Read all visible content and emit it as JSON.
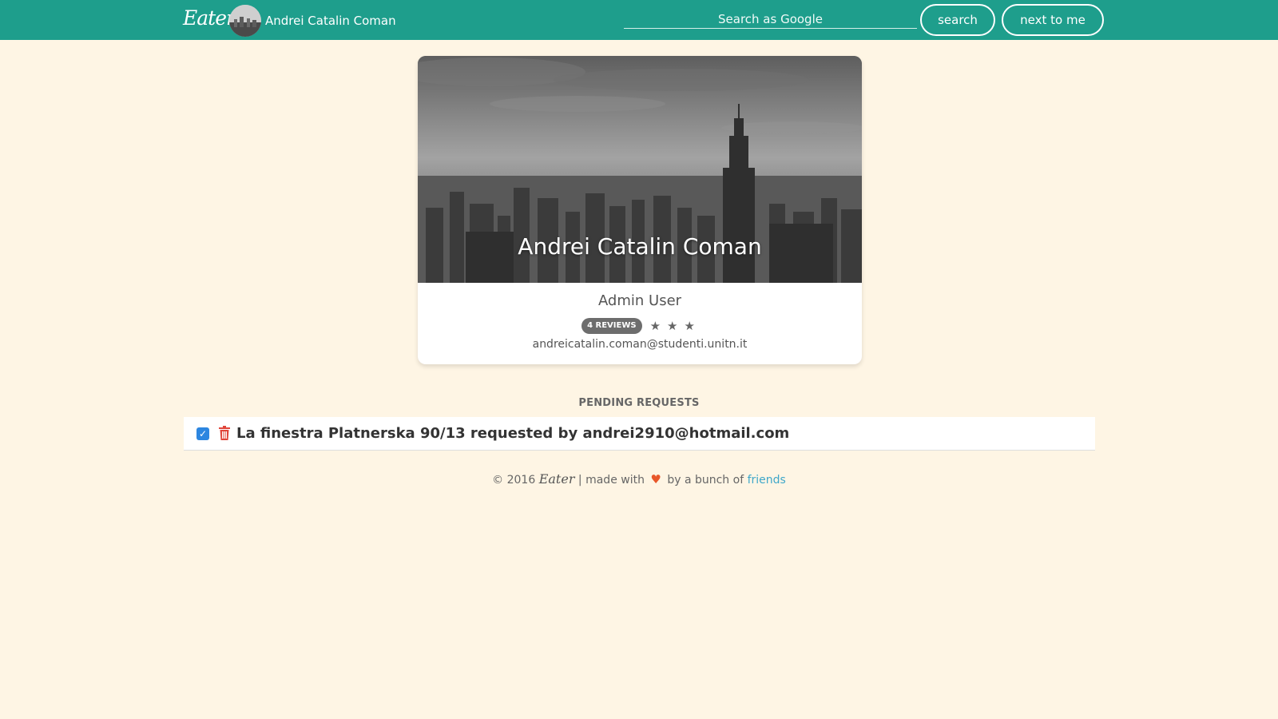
{
  "navbar": {
    "brand": "Eater",
    "username": "Andrei Catalin Coman",
    "search_placeholder": "Search as Google",
    "search_button": "search",
    "next_button": "next to me"
  },
  "profile": {
    "name": "Andrei Catalin Coman",
    "role": "Admin User",
    "reviews_badge": "4 REVIEWS",
    "stars": 3,
    "email": "andreicatalin.coman@studenti.unitn.it"
  },
  "pending": {
    "title": "PENDING REQUESTS",
    "requests": [
      {
        "text": "La finestra Platnerska 90/13 requested by andrei2910@hotmail.com",
        "checked": true
      }
    ]
  },
  "footer": {
    "prefix": "© 2016",
    "brand": "Eater",
    "middle": "| made with",
    "suffix": "by a bunch of",
    "link": "friends"
  },
  "colors": {
    "navbar": "#1e9e8c",
    "background": "#fef5e4",
    "heart": "#e8572a",
    "trash": "#e0453a",
    "checkbox": "#2d86e0",
    "link": "#3fa7c9"
  }
}
